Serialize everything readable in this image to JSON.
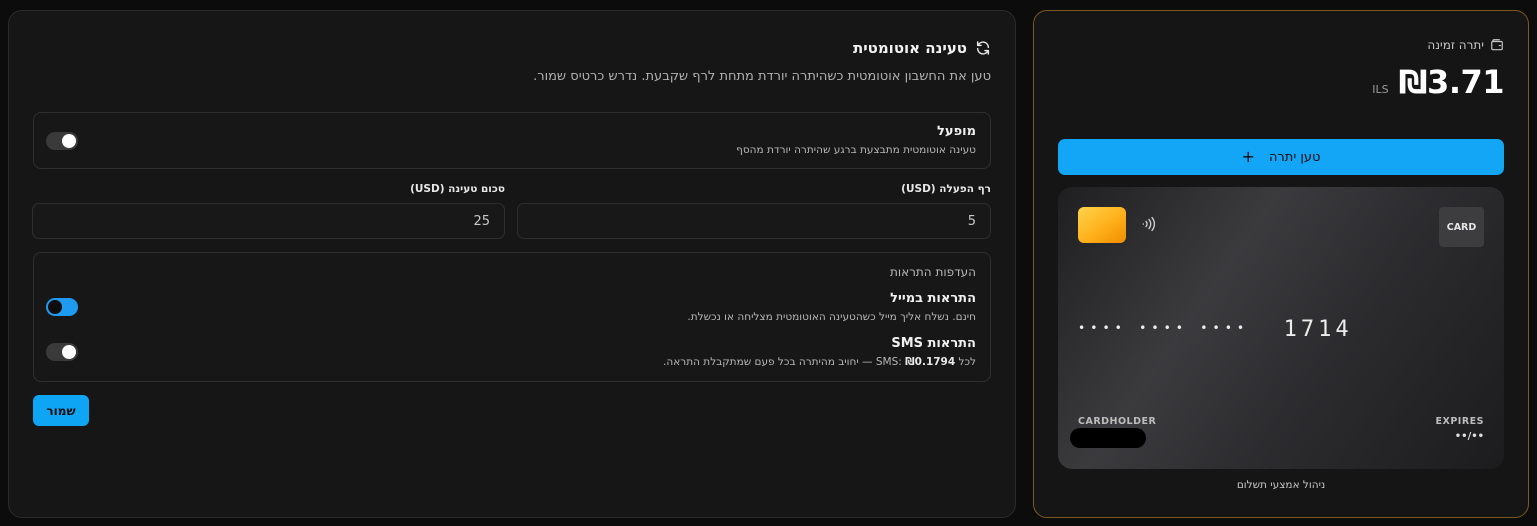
{
  "auto_reload": {
    "title": "טעינה אוטומטית",
    "description": "טען את החשבון אוטומטית כשהיתרה יורדת מתחת לרף שקבעת. נדרש כרטיס שמור.",
    "enabled": {
      "title": "מופעל",
      "subtitle": "טעינה אוטומטית מתבצעת ברגע שהיתרה יורדת מהסף",
      "state": "on"
    },
    "threshold": {
      "label": "רף הפעלה (USD)",
      "value": "5"
    },
    "reload_amount": {
      "label": "סכום טעינה (USD)",
      "value": "25"
    },
    "notifications": {
      "title": "העדפות התראות",
      "email": {
        "title": "התראות במייל",
        "subtitle": "חינם. נשלח אליך מייל כשהטעינה האוטומטית מצליחה או נכשלת.",
        "state": "on"
      },
      "sms": {
        "title": "התראות SMS",
        "subtitle_prefix": "לכל SMS: ",
        "price": "₪0.1794",
        "subtitle_suffix": " — יחויב מהיתרה בכל פעם שמתקבלת התראה.",
        "state": "on"
      }
    },
    "save_label": "שמור"
  },
  "wallet": {
    "balance_label": "יתרה זמינה",
    "balance_amount": "₪3.71",
    "currency": "ILS",
    "topup_label": "טען יתרה",
    "card": {
      "brand": "CARD",
      "masked_groups": "•••• •••• ••••",
      "last4": "1714",
      "holder_label": "CARDHOLDER",
      "expires_label": "EXPIRES",
      "expires_value": "••/••"
    },
    "manage_label": "ניהול אמצעי תשלום"
  },
  "colors": {
    "accent": "#13a6f7",
    "wallet_border": "#7a5a1e",
    "panel_bg": "#161616"
  }
}
